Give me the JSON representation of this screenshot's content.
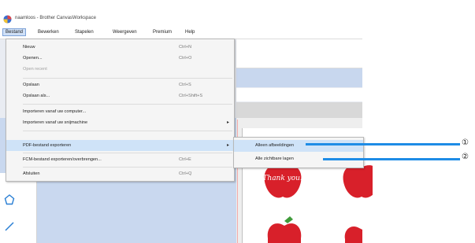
{
  "window": {
    "title": "naamloos - Brother CanvasWorkspace"
  },
  "menubar": {
    "items": [
      "Bestand",
      "Bewerken",
      "Stapelen",
      "Weergeven",
      "Premium",
      "Help"
    ]
  },
  "file_menu": {
    "items": [
      {
        "label": "Nieuw",
        "shortcut": "Ctrl+N"
      },
      {
        "label": "Openen...",
        "shortcut": "Ctrl+O"
      },
      {
        "label": "Open recent",
        "shortcut": ""
      },
      {
        "label": "Opslaan",
        "shortcut": "Ctrl+S"
      },
      {
        "label": "Opslaan als...",
        "shortcut": "Ctrl+Shift+S"
      },
      {
        "label": "Importeren vanaf uw computer...",
        "shortcut": ""
      },
      {
        "label": "Importeren vanaf uw snijmachine",
        "shortcut": ""
      },
      {
        "label": "PDF-bestand exporteren",
        "shortcut": ""
      },
      {
        "label": "FCM-bestand exporteren/overbrengen...",
        "shortcut": "Ctrl+E"
      },
      {
        "label": "Afsluiten",
        "shortcut": "Ctrl+Q"
      }
    ]
  },
  "pdf_submenu": {
    "items": [
      {
        "label": "Alleen afbeeldingen"
      },
      {
        "label": "Alle zichtbare lagen"
      }
    ]
  },
  "callouts": [
    "①",
    "②"
  ],
  "artwork": {
    "text": "Thank you!"
  },
  "colors": {
    "callout": "#1e8ce6",
    "highlight": "#cfe3f8",
    "apple_red": "#d8202a"
  }
}
